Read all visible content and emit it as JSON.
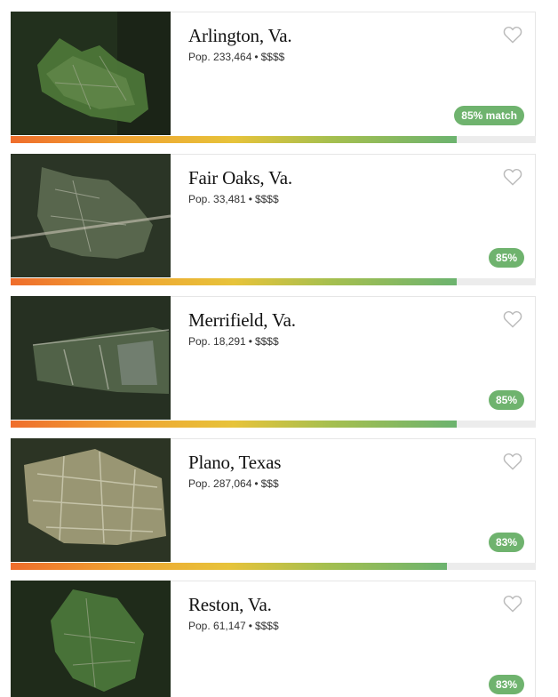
{
  "places": [
    {
      "name": "Arlington, Va.",
      "population": "Pop. 233,464",
      "cost": "$$$$",
      "match_label": "85% match",
      "match_value": 0.85,
      "favorited": false,
      "map_tone": "#3a5a2e"
    },
    {
      "name": "Fair Oaks, Va.",
      "population": "Pop. 33,481",
      "cost": "$$$$",
      "match_label": "85%",
      "match_value": 0.85,
      "favorited": false,
      "map_tone": "#4a5a40"
    },
    {
      "name": "Merrifield, Va.",
      "population": "Pop. 18,291",
      "cost": "$$$$",
      "match_label": "85%",
      "match_value": 0.85,
      "favorited": false,
      "map_tone": "#46573c"
    },
    {
      "name": "Plano, Texas",
      "population": "Pop. 287,064",
      "cost": "$$$",
      "match_label": "83%",
      "match_value": 0.83,
      "favorited": false,
      "map_tone": "#8b8a63"
    },
    {
      "name": "Reston, Va.",
      "population": "Pop. 61,147",
      "cost": "$$$$",
      "match_label": "83%",
      "match_value": 0.83,
      "favorited": false,
      "map_tone": "#3f5f35"
    }
  ],
  "separator": "•",
  "colors": {
    "badge_bg": "#6fb36e",
    "bar_start": "#ef6d2c",
    "bar_end": "#6cb36f",
    "bar_track": "#ececec",
    "heart_outline": "#bbbbbb"
  }
}
